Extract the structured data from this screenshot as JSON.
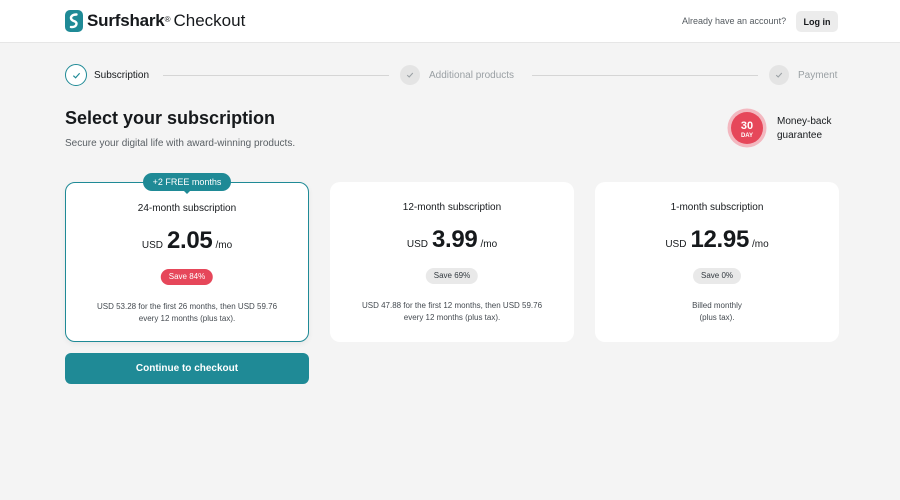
{
  "header": {
    "brand": "Surfshark",
    "brand_mark": "®",
    "section": "Checkout",
    "account_prompt": "Already have an account?",
    "login_label": "Log in"
  },
  "stepper": [
    {
      "label": "Subscription",
      "state": "active"
    },
    {
      "label": "Additional products",
      "state": "inactive"
    },
    {
      "label": "Payment",
      "state": "inactive"
    }
  ],
  "page": {
    "title": "Select your subscription",
    "subtitle": "Secure your digital life with award-winning products."
  },
  "guarantee": {
    "badge_number": "30",
    "badge_unit": "DAY",
    "line1": "Money-back",
    "line2": "guarantee"
  },
  "plans": [
    {
      "title": "24-month subscription",
      "currency": "USD",
      "price": "2.05",
      "period": "/mo",
      "save": "Save 84%",
      "note_line1": "USD 53.28 for the first 26 months, then USD 59.76",
      "note_line2": "every 12 months (plus tax).",
      "promo": "+2 FREE months",
      "selected": true
    },
    {
      "title": "12-month subscription",
      "currency": "USD",
      "price": "3.99",
      "period": "/mo",
      "save": "Save 69%",
      "note_line1": "USD 47.88 for the first 12 months, then USD 59.76",
      "note_line2": "every 12 months (plus tax).",
      "selected": false
    },
    {
      "title": "1-month subscription",
      "currency": "USD",
      "price": "12.95",
      "period": "/mo",
      "save": "Save 0%",
      "note_line1": "Billed monthly",
      "note_line2": "(plus tax).",
      "selected": false
    }
  ],
  "cta": {
    "label": "Continue to checkout"
  },
  "colors": {
    "accent": "#1f8a96",
    "sale": "#e6475a",
    "background": "#f4f4f4"
  },
  "icons": [
    "surfshark-logo-icon",
    "check-icon",
    "money-back-badge-icon"
  ]
}
